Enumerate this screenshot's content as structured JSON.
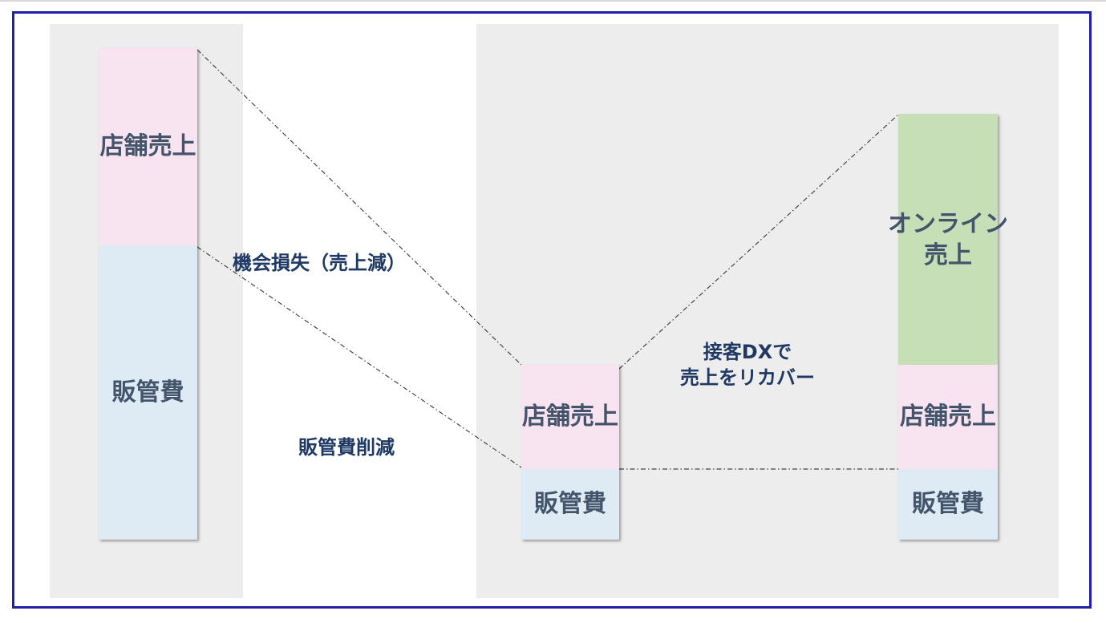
{
  "diagram": {
    "bar_left": {
      "top_label": "店舗売上",
      "bottom_label": "販管費"
    },
    "bar_middle": {
      "top_label": "店舗売上",
      "bottom_label": "販管費"
    },
    "bar_right": {
      "top_label": "オンライン\n売上",
      "middle_label": "店舗売上",
      "bottom_label": "販管費"
    },
    "annotations": {
      "opportunity_loss": "機会損失（売上減）",
      "sga_reduction": "販管費削減",
      "dx_recovery": "接客DXで\n売上をリカバー"
    }
  },
  "colors": {
    "store_sales": "#f8e3f1",
    "sga": "#deebf5",
    "online_sales": "#c6dfb6",
    "label_text": "#44546a",
    "annotation_text": "#1f3864",
    "frame": "#1f1fa8"
  }
}
